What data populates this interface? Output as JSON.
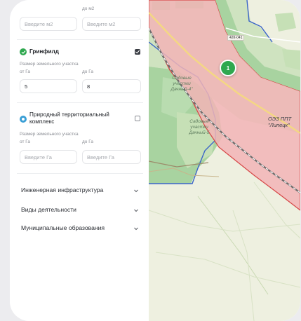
{
  "filters": {
    "area_m2": {
      "to_label": "до м2",
      "from_placeholder": "Введите м2",
      "to_placeholder": "Введите м2"
    },
    "greenfield": {
      "title": "Гринфилд",
      "checked": true,
      "accent": "#2fa84f",
      "size_label": "Размер земельного участка",
      "from_label": "от Га",
      "to_label": "до Га",
      "from_value": "5",
      "to_value": "8"
    },
    "nature_complex": {
      "title": "Природный территориальный комплекс",
      "checked": false,
      "accent": "#3a9fd6",
      "size_label": "Размер земельного участка",
      "from_label": "от Га",
      "to_label": "до Га",
      "from_placeholder": "Введите Га",
      "to_placeholder": "Введите Га"
    },
    "sections": [
      {
        "label": "Инженерная инфраструктура"
      },
      {
        "label": "Виды деятельности"
      },
      {
        "label": "Муниципальные образования"
      }
    ]
  },
  "map": {
    "road_badge": "42К-041",
    "marker_count": "1",
    "zone_label_line1": "ОЭЗ ППТ",
    "zone_label_line2": "\"Липецк\"",
    "garden_label_1": "Садовые участки Дачный-4\"",
    "garden_label_2": "Садовые участки Дачный-5",
    "colors": {
      "zone_fill": "#f2b4b6",
      "zone_stroke": "#d64545",
      "forest": "#a8d3a0",
      "field": "#eef0e0",
      "boundary": "#3a64c8"
    }
  }
}
